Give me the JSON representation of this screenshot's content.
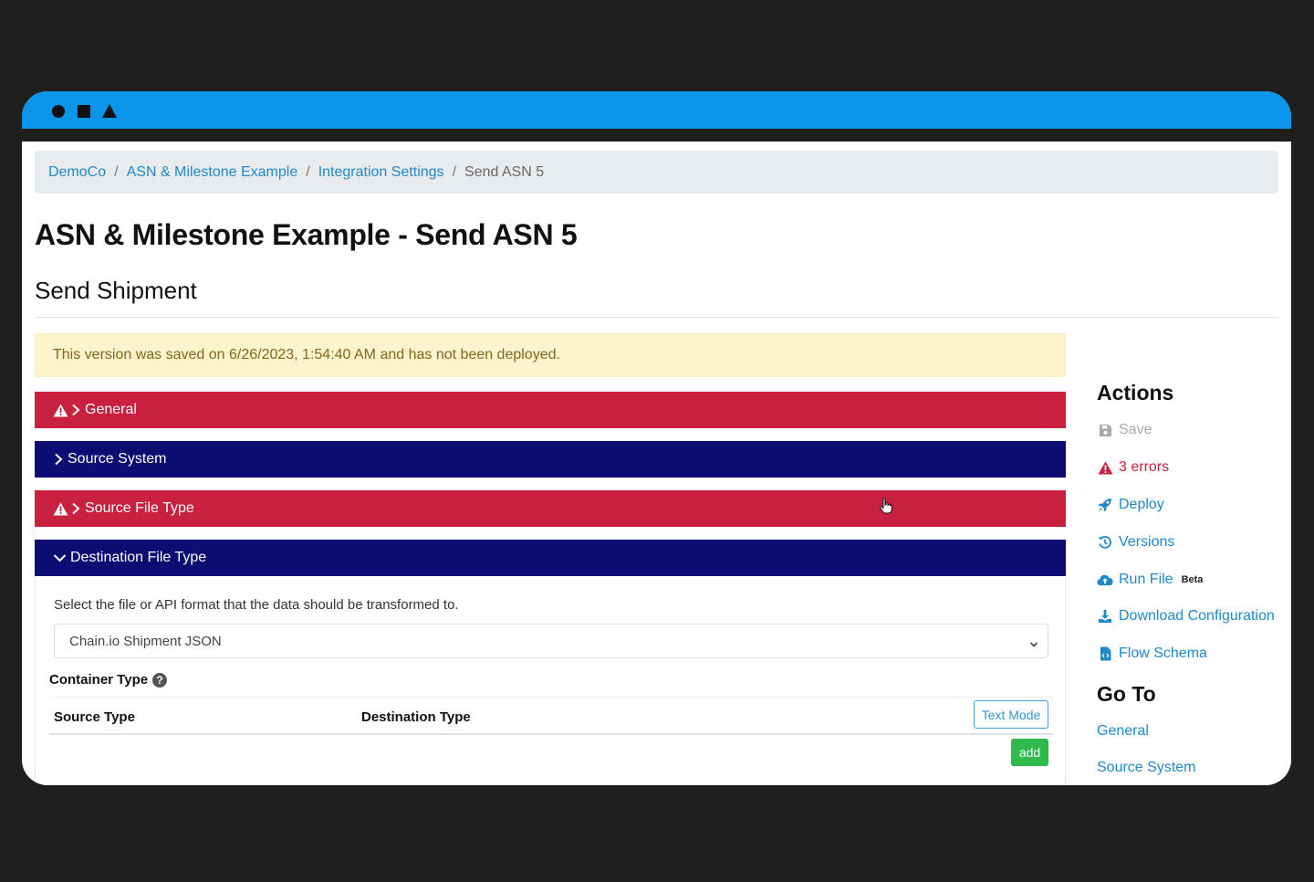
{
  "breadcrumb": {
    "items": [
      "DemoCo",
      "ASN & Milestone Example",
      "Integration Settings"
    ],
    "current": "Send ASN 5",
    "separator": "/"
  },
  "page": {
    "title": "ASN & Milestone Example - Send ASN 5",
    "subtitle": "Send Shipment"
  },
  "alert": {
    "text": "This version was saved on 6/26/2023, 1:54:40 AM and has not been deployed."
  },
  "panels": [
    {
      "label": "General",
      "status": "error"
    },
    {
      "label": "Source System",
      "status": "ok"
    },
    {
      "label": "Source File Type",
      "status": "error"
    },
    {
      "label": "Destination File Type",
      "status": "open"
    }
  ],
  "destination": {
    "description": "Select the file or API format that the data should be transformed to.",
    "selected_format": "Chain.io Shipment JSON",
    "container_type_label": "Container Type",
    "help_glyph": "?",
    "col_source": "Source Type",
    "col_destination": "Destination Type",
    "text_mode_label": "Text Mode",
    "add_label": "add"
  },
  "actions": {
    "heading": "Actions",
    "items": {
      "save": "Save",
      "errors": "3 errors",
      "deploy": "Deploy",
      "versions": "Versions",
      "run_file": "Run File",
      "run_file_badge": "Beta",
      "download": "Download Configuration",
      "schema": "Flow Schema"
    }
  },
  "goto": {
    "heading": "Go To",
    "links": [
      "General",
      "Source System"
    ]
  },
  "colors": {
    "titlebar": "#0895ea",
    "error_panel": "#c92040",
    "info_panel": "#0b0d72",
    "link": "#1e88c9",
    "alert_bg": "#fdf3cd",
    "add_button": "#2fba4d"
  },
  "icons": {
    "window_controls": [
      "circle-icon",
      "square-icon",
      "triangle-icon"
    ],
    "warning": "warning-triangle-icon",
    "save": "floppy-disk-icon",
    "deploy": "rocket-icon",
    "versions": "history-icon",
    "run_file": "cloud-upload-icon",
    "download": "download-icon",
    "schema": "file-code-icon"
  }
}
